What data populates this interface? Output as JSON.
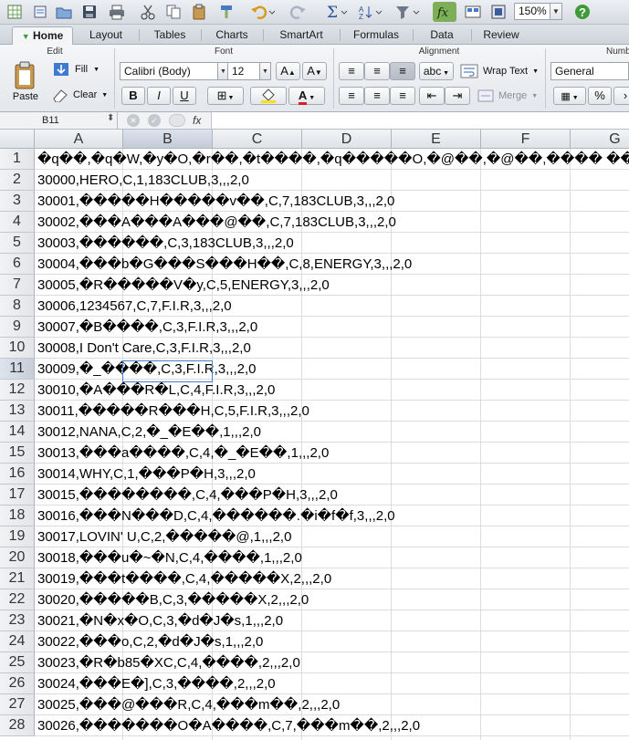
{
  "toolbar": {
    "zoom": "150%",
    "icons": [
      "new-sheet-icon",
      "open-folder-icon",
      "save-icon",
      "print-icon",
      "cut-icon",
      "copy-icon",
      "paste-icon",
      "format-painter-icon",
      "undo-icon",
      "redo-icon",
      "autosum-icon",
      "sort-icon",
      "filter-icon",
      "formula-builder-icon",
      "gallery-icon",
      "help-icon"
    ]
  },
  "ribbon_tabs": [
    "Home",
    "Layout",
    "Tables",
    "Charts",
    "SmartArt",
    "Formulas",
    "Data",
    "Review"
  ],
  "ribbon": {
    "edit_label": "Edit",
    "font_label": "Font",
    "alignment_label": "Alignment",
    "number_label": "Numbe",
    "paste": "Paste",
    "fill": "Fill",
    "clear": "Clear",
    "font_name": "Calibri (Body)",
    "font_size": "12",
    "bold": "B",
    "italic": "I",
    "underline": "U",
    "abc": "abc",
    "wrap_text": "Wrap Text",
    "merge": "Merge",
    "number_format": "General",
    "percent": "%"
  },
  "formula_bar": {
    "name_box": "B11",
    "fx": "fx",
    "value": ""
  },
  "columns": [
    "A",
    "B",
    "C",
    "D",
    "E",
    "F",
    "G"
  ],
  "rows": [
    {
      "n": "1",
      "text": "�q��,�q�W,�y�O,�r��,�t����,�q�����O,�@��,�@��,���� ���y,�������O"
    },
    {
      "n": "2",
      "text": "30000,HERO,C,1,183CLUB,3,,,2,0"
    },
    {
      "n": "3",
      "text": "30001,�����H�����v��,C,7,183CLUB,3,,,2,0"
    },
    {
      "n": "4",
      "text": "30002,���A���A���@��,C,7,183CLUB,3,,,2,0"
    },
    {
      "n": "5",
      "text": "30003,������,C,3,183CLUB,3,,,2,0"
    },
    {
      "n": "6",
      "text": "30004,���b�G���S���H��,C,8,ENERGY,3,,,2,0"
    },
    {
      "n": "7",
      "text": "30005,�R�����V�y,C,5,ENERGY,3,,,2,0"
    },
    {
      "n": "8",
      "text": "30006,1234567,C,7,F.I.R,3,,,2,0"
    },
    {
      "n": "9",
      "text": "30007,�B����,C,3,F.I.R,3,,,2,0"
    },
    {
      "n": "10",
      "text": "30008,I Don't Care,C,3,F.I.R,3,,,2,0"
    },
    {
      "n": "11",
      "text": "30009,�_����,C,3,F.I.R,3,,,2,0"
    },
    {
      "n": "12",
      "text": "30010,�A���R�L,C,4,F.I.R,3,,,2,0"
    },
    {
      "n": "13",
      "text": "30011,�����R���H,C,5,F.I.R,3,,,2,0"
    },
    {
      "n": "14",
      "text": "30012,NANA,C,2,�_�E��,1,,,2,0"
    },
    {
      "n": "15",
      "text": "30013,���a����,C,4,�_�E��,1,,,2,0"
    },
    {
      "n": "16",
      "text": "30014,WHY,C,1,���P�H,3,,,2,0"
    },
    {
      "n": "17",
      "text": "30015,��������,C,4,���P�H,3,,,2,0"
    },
    {
      "n": "18",
      "text": "30016,���N���D,C,4,������.�i�f�f,3,,,2,0"
    },
    {
      "n": "19",
      "text": "30017,LOVIN' U,C,2,�����@,1,,,2,0"
    },
    {
      "n": "20",
      "text": "30018,���u�~�N,C,4,����,1,,,2,0"
    },
    {
      "n": "21",
      "text": "30019,���t����,C,4,�����X,2,,,2,0"
    },
    {
      "n": "22",
      "text": "30020,�����B,C,3,�����X,2,,,2,0"
    },
    {
      "n": "23",
      "text": "30021,�N�x�O,C,3,�d�J�s,1,,,2,0"
    },
    {
      "n": "24",
      "text": "30022,���o,C,2,�d�J�s,1,,,2,0"
    },
    {
      "n": "25",
      "text": "30023,�R�b85�XC,C,4,����,2,,,2,0"
    },
    {
      "n": "26",
      "text": "30024,���E�],C,3,����,2,,,2,0"
    },
    {
      "n": "27",
      "text": "30025,���@���R,C,4,���m��,2,,,2,0"
    },
    {
      "n": "28",
      "text": "30026,�������O�A����,C,7,���m��,2,,,2,0"
    }
  ]
}
